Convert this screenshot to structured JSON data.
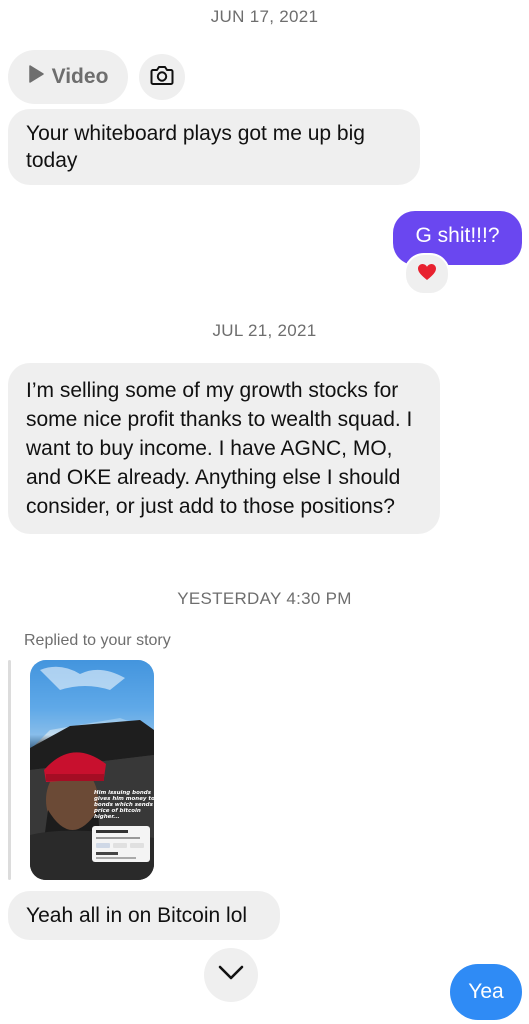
{
  "thread": {
    "timestamp_1": "JUN 17, 2021",
    "video_label": "Video",
    "msg_1": "Your whiteboard plays got me up big today",
    "reply_1": "G shit!!!?",
    "reaction_1": "❤️",
    "timestamp_2": "JUL 21, 2021",
    "msg_2": "I’m selling some of my growth stocks for some nice profit thanks to wealth squad. I want to buy income. I have AGNC, MO, and OKE already. Anything else I should consider, or just add to those positions?",
    "timestamp_3": "YESTERDAY 4:30 PM",
    "replied_label": "Replied to your story",
    "story_caption": "Him issuing bonds gives him money to buy bonds which sends the price of bitcoin higher...",
    "story_card_title": "MicroStrategy Inc",
    "msg_3": "Yeah all in on Bitcoin lol",
    "reply_2": "Yea"
  },
  "colors": {
    "incoming_bubble": "#efefef",
    "outgoing_purple": "#6a47f0",
    "outgoing_blue": "#2f8bf5"
  },
  "icons": {
    "play": "play-icon",
    "camera": "camera-icon",
    "heart": "heart-icon",
    "chevron": "chevron-down-icon"
  }
}
